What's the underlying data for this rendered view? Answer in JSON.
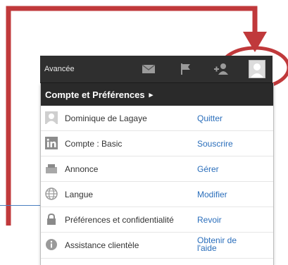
{
  "toolbar": {
    "advanced_label": "Avancée",
    "icons": [
      "mail-icon",
      "flag-icon",
      "add-connection-icon",
      "avatar"
    ]
  },
  "panel": {
    "header_label": "Compte et Préférences",
    "header_arrow": "▸",
    "rows": [
      {
        "icon": "user-photo-icon",
        "label": "Dominique de Lagaye",
        "action": "Quitter"
      },
      {
        "icon": "linkedin-icon",
        "label": "Compte : Basic",
        "action": "Souscrire"
      },
      {
        "icon": "ad-icon",
        "label": "Annonce",
        "action": "Gérer"
      },
      {
        "icon": "globe-icon",
        "label": "Langue",
        "action": "Modifier"
      },
      {
        "icon": "lock-icon",
        "label": "Préférences et confidentialité",
        "action": "Revoir"
      },
      {
        "icon": "info-icon",
        "label": "Assistance clientèle",
        "action_line1": "Obtenir de",
        "action_line2": "l'aide"
      }
    ]
  },
  "colors": {
    "annotation_red": "#c0393b",
    "link_blue": "#2a6ebb",
    "toolbar_bg": "#2f2f2f"
  }
}
